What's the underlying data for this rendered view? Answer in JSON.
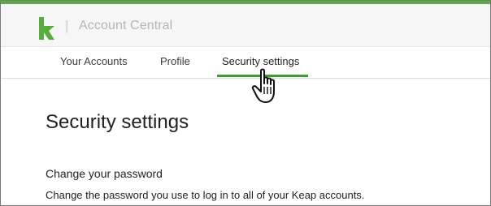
{
  "header": {
    "logo_icon": "keap-k-logo-icon",
    "separator": "|",
    "app_title": "Account Central",
    "brand_color": "#58ac3e"
  },
  "nav": {
    "tabs": [
      {
        "label": "Your Accounts",
        "active": false
      },
      {
        "label": "Profile",
        "active": false
      },
      {
        "label": "Security settings",
        "active": true
      }
    ],
    "active_underline_color": "#3f9b33"
  },
  "main": {
    "page_title": "Security settings",
    "sections": [
      {
        "title": "Change your password",
        "description": "Change the password you use to log in to all of your Keap accounts."
      }
    ]
  },
  "cursor": {
    "icon": "hand-pointer-cursor-icon"
  }
}
